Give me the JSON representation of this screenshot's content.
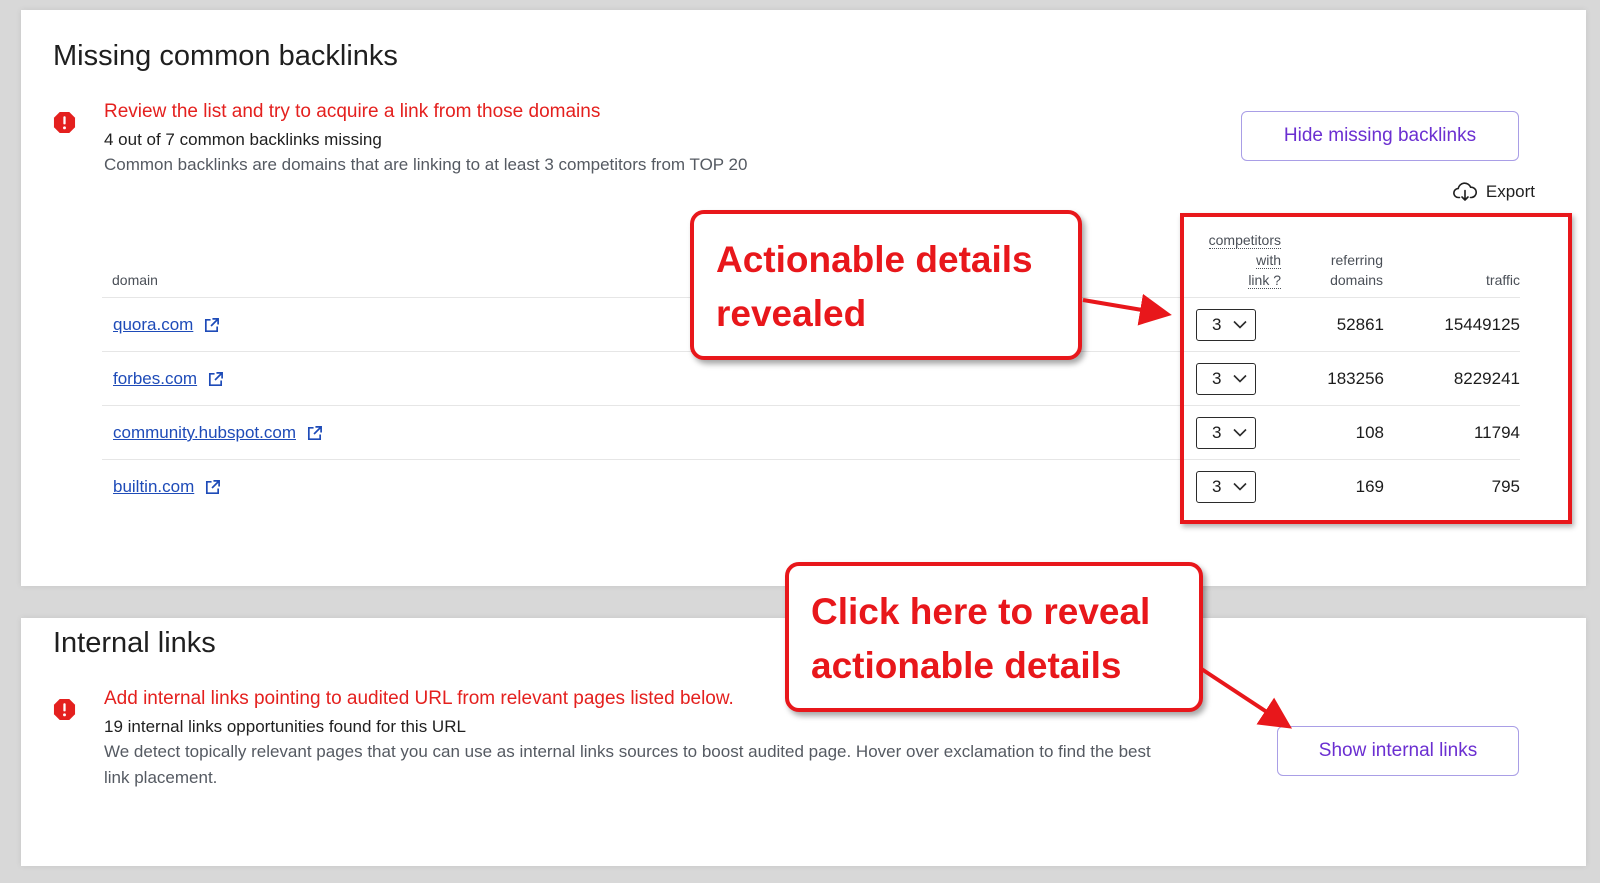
{
  "backlinks_card": {
    "title": "Missing common backlinks",
    "alert_heading": "Review the list and try to acquire a link from those domains",
    "alert_summary": "4 out of 7 common backlinks missing",
    "alert_description": "Common backlinks are domains that are linking to at least 3 competitors from TOP 20",
    "hide_button_label": "Hide missing backlinks",
    "export_label": "Export",
    "columns": {
      "domain": "domain",
      "competitors_line1": "competitors",
      "competitors_line2": "with",
      "competitors_line3": "link ?",
      "referring_line1": "referring",
      "referring_line2": "domains",
      "traffic": "traffic"
    },
    "rows": [
      {
        "domain": "quora.com",
        "competitors": "3",
        "referring_domains": "52861",
        "traffic": "15449125"
      },
      {
        "domain": "forbes.com",
        "competitors": "3",
        "referring_domains": "183256",
        "traffic": "8229241"
      },
      {
        "domain": "community.hubspot.com",
        "competitors": "3",
        "referring_domains": "108",
        "traffic": "11794"
      },
      {
        "domain": "builtin.com",
        "competitors": "3",
        "referring_domains": "169",
        "traffic": "795"
      }
    ]
  },
  "internal_card": {
    "title": "Internal links",
    "alert_heading": "Add internal links pointing to audited URL from relevant pages listed below.",
    "alert_summary": "19 internal links opportunities found for this URL",
    "alert_description_line1": "We detect topically relevant pages that you can use as internal links sources to boost audited page. Hover over exclamation to find the best",
    "alert_description_line2": "link placement.",
    "show_button_label": "Show internal links"
  },
  "annotations": {
    "callout_top_line1": "Actionable details",
    "callout_top_line2": "revealed",
    "callout_bottom_line1": "Click here to reveal",
    "callout_bottom_line2": "actionable details"
  },
  "colors": {
    "alert_red": "#e4201e",
    "button_purple": "#6b2fd1",
    "link_blue": "#1e4bb8",
    "annotation_red": "#e8171b"
  }
}
